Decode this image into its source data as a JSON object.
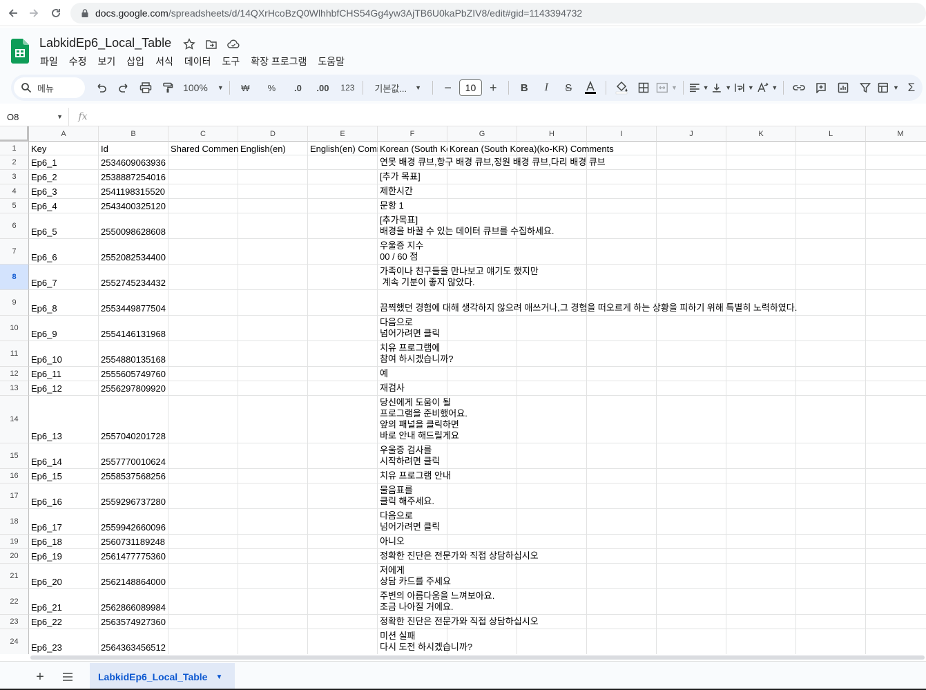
{
  "browser": {
    "url_host": "docs.google.com",
    "url_path": "/spreadsheets/d/14QXrHcoBzQ0WlhhbfCHS54Gg4yw3AjTB6U0kaPbZIV8/edit#gid=1143394732"
  },
  "doc": {
    "title": "LabkidEp6_Local_Table"
  },
  "menu": [
    "파일",
    "수정",
    "보기",
    "삽입",
    "서식",
    "데이터",
    "도구",
    "확장 프로그램",
    "도움말"
  ],
  "toolbar": {
    "search_label": "메뉴",
    "zoom": "100%",
    "currency": "₩",
    "percent": "%",
    "dec_decrease": ".0",
    "dec_increase": ".00",
    "number_format": "123",
    "font": "기본값...",
    "font_size": "10"
  },
  "formula_bar": {
    "cell_ref": "O8",
    "fx": "fx"
  },
  "grid": {
    "columns": [
      "A",
      "B",
      "C",
      "D",
      "E",
      "F",
      "G",
      "H",
      "I",
      "J",
      "K",
      "L",
      "M"
    ],
    "header_row": {
      "A": "Key",
      "B": "Id",
      "C": "Shared Comments",
      "D": "English(en)",
      "E": "English(en) Comments",
      "F": "Korean (South Korea)(ko-KR)",
      "G": "Korean (South Korea)(ko-KR) Comments"
    },
    "rows": [
      {
        "num": "1"
      },
      {
        "num": "2",
        "key": "Ep6_1",
        "id": "2534609063936",
        "ko": "연못 배경 큐브,항구 배경 큐브,정원 배경 큐브,다리 배경 큐브"
      },
      {
        "num": "3",
        "key": "Ep6_2",
        "id": "2538887254016",
        "ko": "[추가 목표]"
      },
      {
        "num": "4",
        "key": "Ep6_3",
        "id": "2541198315520",
        "ko": "제한시간"
      },
      {
        "num": "5",
        "key": "Ep6_4",
        "id": "2543400325120",
        "ko": "문항 1"
      },
      {
        "num": "6",
        "key": "Ep6_5",
        "id": "2550098628608",
        "ko": "[추가목표]\n배경을 바꿀 수 있는 데이터 큐브를 수집하세요."
      },
      {
        "num": "7",
        "key": "Ep6_6",
        "id": "2552082534400",
        "ko": "우울증 지수\n00 / 60 점"
      },
      {
        "num": "8",
        "key": "Ep6_7",
        "id": "2552745234432",
        "ko": "가족이나 친구들을 만나보고 얘기도 했지만\n 계속 기분이 좋지 않았다."
      },
      {
        "num": "9",
        "key": "Ep6_8",
        "id": "2553449877504",
        "ko": "끔찍했던 경험에 대해 생각하지 않으려 애쓰거나,그 경험을 떠오르게 하는 상황을 피하기 위해 특별히 노력하였다."
      },
      {
        "num": "10",
        "key": "Ep6_9",
        "id": "2554146131968",
        "ko": "다음으로\n넘어가려면 클릭"
      },
      {
        "num": "11",
        "key": "Ep6_10",
        "id": "2554880135168",
        "ko": "치유 프로그램에\n참여 하시겠습니까?"
      },
      {
        "num": "12",
        "key": "Ep6_11",
        "id": "2555605749760",
        "ko": "예"
      },
      {
        "num": "13",
        "key": "Ep6_12",
        "id": "2556297809920",
        "ko": "재검사"
      },
      {
        "num": "14",
        "key": "Ep6_13",
        "id": "2557040201728",
        "ko": "당신에게 도움이 될\n프로그램을 준비했어요.\n앞의 패널을 클릭하면\n바로 안내 해드릴게요"
      },
      {
        "num": "15",
        "key": "Ep6_14",
        "id": "2557770010624",
        "ko": "우울증 검사를\n시작하려면 클릭"
      },
      {
        "num": "16",
        "key": "Ep6_15",
        "id": "2558537568256",
        "ko": "치유 프로그램 안내"
      },
      {
        "num": "17",
        "key": "Ep6_16",
        "id": "2559296737280",
        "ko": "물음표를\n클릭 해주세요."
      },
      {
        "num": "18",
        "key": "Ep6_17",
        "id": "2559942660096",
        "ko": "다음으로\n넘어가려면 클릭"
      },
      {
        "num": "19",
        "key": "Ep6_18",
        "id": "2560731189248",
        "ko": "아니오"
      },
      {
        "num": "20",
        "key": "Ep6_19",
        "id": "2561477775360",
        "ko": "정확한 진단은 전문가와 직접 상담하십시오"
      },
      {
        "num": "21",
        "key": "Ep6_20",
        "id": "2562148864000",
        "ko": "저에게\n상담 카드를 주세요"
      },
      {
        "num": "22",
        "key": "Ep6_21",
        "id": "2562866089984",
        "ko": "주변의 아름다움을 느껴보아요.\n조금 나아질 거에요."
      },
      {
        "num": "23",
        "key": "Ep6_22",
        "id": "2563574927360",
        "ko": "정확한 진단은 전문가와 직접 상담하십시오"
      },
      {
        "num": "24",
        "key": "Ep6_23",
        "id": "2564363456512",
        "ko": "미션 실패\n다시 도전 하시겠습니까?"
      }
    ],
    "selected_row": "8"
  },
  "sheet_tabs": [
    {
      "label": "LabkidEp6_Local_Table",
      "active": true
    }
  ],
  "colors": {
    "accent": "#0b57d0",
    "sheets_green": "#0f9d58",
    "toolbar_bg": "#edf2fa"
  }
}
